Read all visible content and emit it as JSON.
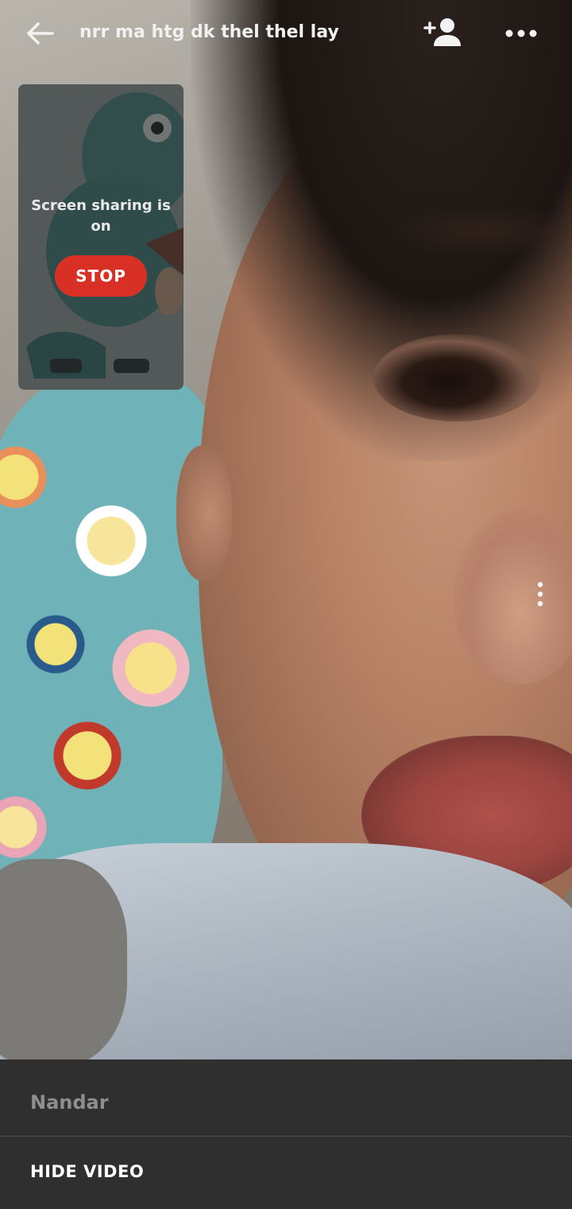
{
  "call": {
    "title": "nrr ma htg dk thel thel lay"
  },
  "self_preview": {
    "status_text": "Screen sharing is on",
    "stop_label": "STOP"
  },
  "bottom_sheet": {
    "participant_name": "Nandar",
    "hide_video_label": "HIDE VIDEO"
  },
  "icons": {
    "back": "back-arrow-icon",
    "add_person": "add-person-icon",
    "more": "more-horizontal-icon",
    "video_options": "more-vertical-icon"
  },
  "colors": {
    "stop_button": "#d93025",
    "sheet_background": "#2f2f2f",
    "participant_name": "#8e8e8e",
    "sheet_text": "#ffffff"
  }
}
